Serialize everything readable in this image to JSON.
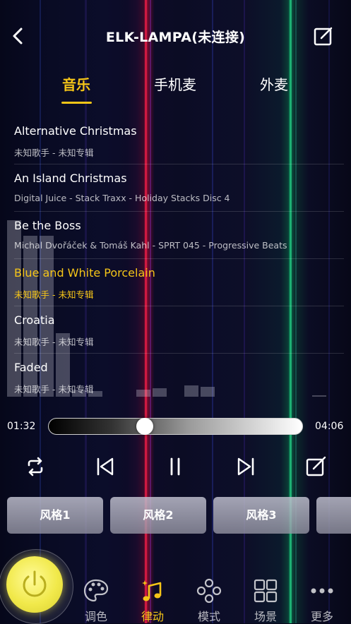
{
  "colors": {
    "accent": "#f5c518",
    "background": "#07081a"
  },
  "header": {
    "title": "ELK-LAMPA(未连接)",
    "back_icon": "chevron-left-icon",
    "edit_icon": "edit-icon"
  },
  "tabs": [
    {
      "label": "音乐",
      "active": true
    },
    {
      "label": "手机麦",
      "active": false
    },
    {
      "label": "外麦",
      "active": false
    }
  ],
  "songs": [
    {
      "title": "Alternative Christmas",
      "meta": "未知歌手 - 未知专辑",
      "playing": false
    },
    {
      "title": "An Island Christmas",
      "meta": "Digital Juice - Stack Traxx - Holiday Stacks Disc 4",
      "playing": false
    },
    {
      "title": "Be the Boss",
      "meta": "Michal Dvořáček & Tomáš Kahl - SPRT 045 - Progressive Beats",
      "playing": false
    },
    {
      "title": "Blue and White Porcelain",
      "meta": "未知歌手 - 未知专辑",
      "playing": true
    },
    {
      "title": "Croatia",
      "meta": "未知歌手 - 未知专辑",
      "playing": false
    },
    {
      "title": "Faded",
      "meta": "未知歌手 - 未知专辑",
      "playing": false
    }
  ],
  "player": {
    "current_time": "01:32",
    "total_time": "04:06",
    "progress": 0.37,
    "controls": [
      "repeat-icon",
      "previous-icon",
      "pause-icon",
      "next-icon",
      "edit-icon"
    ]
  },
  "styles": [
    {
      "label": "风格1"
    },
    {
      "label": "风格2"
    },
    {
      "label": "风格3"
    }
  ],
  "nav": [
    {
      "label": "调色",
      "icon": "palette-icon",
      "active": false
    },
    {
      "label": "律动",
      "icon": "music-notes-icon",
      "active": true
    },
    {
      "label": "模式",
      "icon": "mode-icon",
      "active": false
    },
    {
      "label": "场景",
      "icon": "grid-icon",
      "active": false
    },
    {
      "label": "更多",
      "icon": "more-icon",
      "active": false
    }
  ],
  "power_icon": "power-icon"
}
